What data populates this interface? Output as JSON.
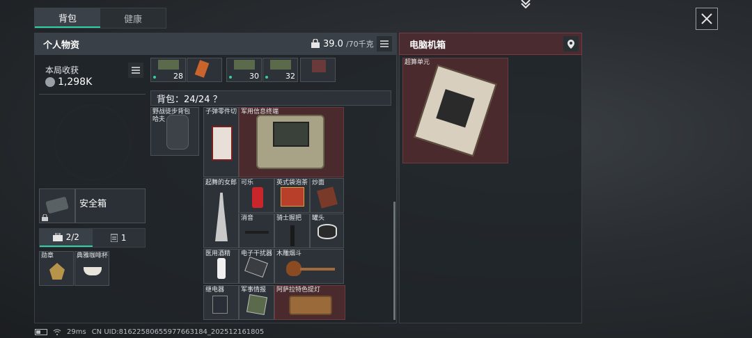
{
  "tabs": [
    "背包",
    "健康"
  ],
  "left_panel": {
    "title": "个人物资",
    "weight": "39.0",
    "weight_max": "/70千克"
  },
  "right_panel": {
    "title": "电脑机箱",
    "item_label": "超算单元"
  },
  "harvest": {
    "title": "本局收获",
    "value": "1,298K"
  },
  "safe_box": {
    "label": "安全箱"
  },
  "subtabs": {
    "first": "2/2",
    "second": "1"
  },
  "special_items": [
    "勋章",
    "典雅咖啡杯"
  ],
  "top_row_counts": [
    "28",
    "30",
    "32"
  ],
  "backpack": {
    "title": "背包：24/24 ？",
    "bag_label": "野战徒步背包",
    "bag_sub": "哈夫",
    "items": [
      {
        "label": "子弹零件切"
      },
      {
        "label": "军用信息终端"
      },
      {
        "label": "起舞的女郎"
      },
      {
        "label": "可乐"
      },
      {
        "label": "英式袋泡茶"
      },
      {
        "label": "炒面"
      },
      {
        "label": "消音"
      },
      {
        "label": "骑士握把"
      },
      {
        "label": "罐头"
      },
      {
        "label": "医用酒精"
      },
      {
        "label": "电子干扰器"
      },
      {
        "label": "木雕烟斗"
      },
      {
        "label": "继电器"
      },
      {
        "label": "军事情报"
      },
      {
        "label": "阿萨拉特色提灯"
      }
    ]
  },
  "status_bar": {
    "ping": "29ms",
    "uid": "CN UID:816225806559776631​84_202512161805"
  },
  "colors": {
    "accent": "#2fd1a6",
    "red_slot": "#4a2a2c"
  }
}
